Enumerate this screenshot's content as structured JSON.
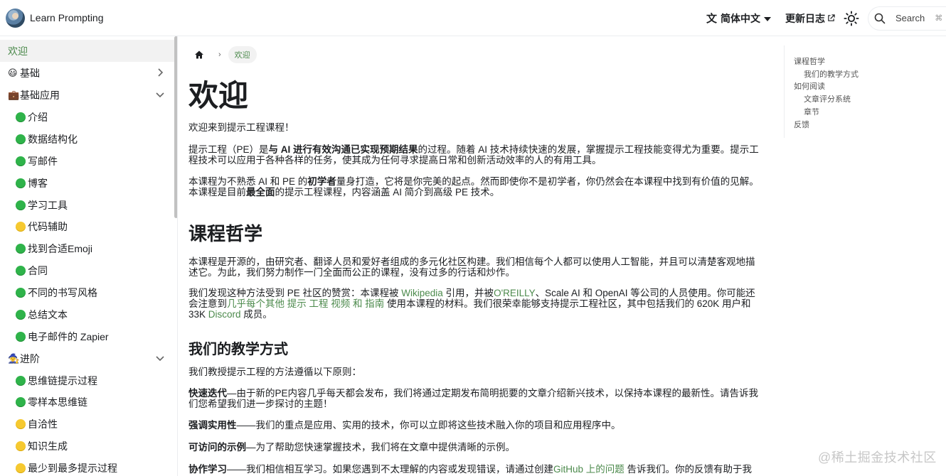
{
  "navbar": {
    "brand_title": "Learn Prompting",
    "language_label": "简体中文",
    "changelog_label": "更新日志",
    "search_label": "Search",
    "search_kbd": "⌘"
  },
  "sidebar": {
    "items": [
      {
        "label": "欢迎",
        "prefix": ""
      },
      {
        "label": "基础",
        "prefix": "😃"
      },
      {
        "label": "基础应用",
        "prefix": "💼"
      },
      {
        "label": "介绍"
      },
      {
        "label": "数据结构化"
      },
      {
        "label": "写邮件"
      },
      {
        "label": "博客"
      },
      {
        "label": "学习工具"
      },
      {
        "label": "代码辅助"
      },
      {
        "label": "找到合适Emoji"
      },
      {
        "label": "合同"
      },
      {
        "label": "不同的书写风格"
      },
      {
        "label": "总结文本"
      },
      {
        "label": "电子邮件的 Zapier"
      },
      {
        "label": "进阶",
        "prefix": "🧙"
      },
      {
        "label": "思维链提示过程"
      },
      {
        "label": "零样本思维链"
      },
      {
        "label": "自洽性"
      },
      {
        "label": "知识生成"
      },
      {
        "label": "最少到最多提示过程"
      }
    ]
  },
  "breadcrumb": {
    "current": "欢迎"
  },
  "content": {
    "title": "欢迎",
    "intro": "欢迎来到提示工程课程！",
    "p1_a": "提示工程（PE）是",
    "p1_b": "与 AI 进行有效沟通已实现预期结果",
    "p1_c": "的过程。随着 AI 技术持续快速的发展，掌握提示工程技能变得尤为重要。提示工程技术可以应用于各种各样的任务，使其成为任何寻求提高日常和创新活动效率的人的有用工具。",
    "p2_a": "本课程为不熟悉 AI 和 PE 的",
    "p2_b": "初学者",
    "p2_c": "量身打造，它将是你完美的起点。然而即使你不是初学者，你仍然会在本课程中找到有价值的见解。本课程是目前",
    "p2_d": "最全面",
    "p2_e": "的提示工程课程，内容涵盖 AI 简介到高级 PE 技术。",
    "h2_philosophy": "课程哲学",
    "p3": "本课程是开源的，由研究者、翻译人员和爱好者组成的多元化社区构建。我们相信每个人都可以使用人工智能，并且可以清楚客观地描述它。为此，我们努力制作一门全面而公正的课程，没有过多的行话和炒作。",
    "p4_a": "我们发现这种方法受到 PE 社区的赞赏：本课程被 ",
    "p4_wiki": "Wikipedia",
    "p4_b": " 引用，并被",
    "p4_oreilly": "O'REILLY",
    "p4_c": "、Scale AI 和 OpenAI 等公司的人员使用。你可能还会注意到",
    "p4_links": "几乎每个其他 提示 工程 视频 和 指南",
    "p4_d": " 使用本课程的材料。我们很荣幸能够支持提示工程社区，其中包括我们的 620K 用户和 33K ",
    "p4_discord": "Discord",
    "p4_e": " 成员。",
    "h3_teaching": "我们的教学方式",
    "p5": "我们教授提示工程的方法遵循以下原则：",
    "p6_b": "快速迭代",
    "p6": "—由于新的PE内容几乎每天都会发布，我们将通过定期发布简明扼要的文章介绍新兴技术，以保持本课程的最新性。请告诉我们您希望我们进一步探讨的主题！",
    "p7_b": "强调实用性",
    "p7": "——我们的重点是应用、实用的技术，你可以立即将这些技术融入你的项目和应用程序中。",
    "p8_b": "可访问的示例",
    "p8": "—为了帮助您快速掌握技术，我们将在文章中提供清晰的示例。",
    "p9_b": "协作学习",
    "p9": "——我们相信相互学习。如果您遇到不太理解的内容或发现错误，请通过创建",
    "p9_link": "GitHub 上的问题",
    "p9_c": " 告诉我们。你的反馈有助于我"
  },
  "toc": {
    "items": [
      {
        "label": "课程哲学",
        "level": 1
      },
      {
        "label": "我们的教学方式",
        "level": 2
      },
      {
        "label": "如何阅读",
        "level": 1
      },
      {
        "label": "文章评分系统",
        "level": 2
      },
      {
        "label": "章节",
        "level": 2
      },
      {
        "label": "反馈",
        "level": 1
      }
    ]
  },
  "watermark": "@稀土掘金技术社区",
  "colors": {
    "accent": "#4c8a4c",
    "border": "#ebedf0",
    "active_bg": "#f2f2f2"
  }
}
